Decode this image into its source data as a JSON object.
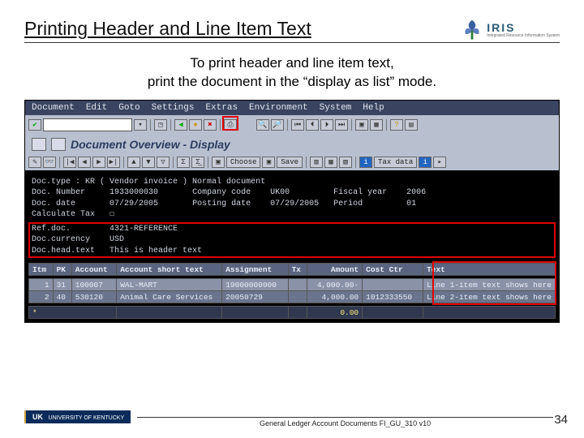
{
  "title": "Printing Header and Line Item Text",
  "subtitle_line1": "To print header and line item text,",
  "subtitle_line2": "print the document in the “display as list” mode.",
  "logo": {
    "text": "IRIS",
    "sub": "Integrated Resource Information System"
  },
  "sap": {
    "menu": [
      "Document",
      "Edit",
      "Goto",
      "Settings",
      "Extras",
      "Environment",
      "System",
      "Help"
    ],
    "overview_title": "Document Overview - Display",
    "toolbar2_buttons": {
      "choose": "Choose",
      "save": "Save",
      "taxdata": "Tax data"
    },
    "header_fields": {
      "doc_type_label": "Doc.type :",
      "doc_type_value": "KR ( Vendor invoice ) Normal document",
      "doc_number_label": "Doc. Number",
      "doc_number_value": "1933000030",
      "company_code_label": "Company code",
      "company_code_value": "UK00",
      "fiscal_year_label": "Fiscal year",
      "fiscal_year_value": "2006",
      "doc_date_label": "Doc. date",
      "doc_date_value": "07/29/2005",
      "posting_date_label": "Posting date",
      "posting_date_value": "07/29/2005",
      "period_label": "Period",
      "period_value": "01",
      "calc_tax_label": "Calculate Tax",
      "ref_doc_label": "Ref.doc.",
      "ref_doc_value": "4321-REFERENCE",
      "doc_currency_label": "Doc.currency",
      "doc_currency_value": "USD",
      "doc_head_text_label": "Doc.head.text",
      "doc_head_text_value": "This is header text"
    },
    "table": {
      "headers": [
        "Itm",
        "PK",
        "Account",
        "Account short text",
        "Assignment",
        "Tx",
        "Amount",
        "Cost Ctr",
        "Text"
      ],
      "rows": [
        {
          "itm": "1",
          "pk": "31",
          "account": "100007",
          "short": "WAL-MART",
          "assign": "19000000000",
          "tx": "",
          "amount": "4,000.00-",
          "cost": "",
          "text": "Line 1-item text shows here"
        },
        {
          "itm": "2",
          "pk": "40",
          "account": "530120",
          "short": "Animal Care Services",
          "assign": "20050729",
          "tx": "",
          "amount": "4,000.00",
          "cost": "1012333550",
          "text": "Line 2-item text shows here"
        }
      ],
      "total_amount": "0.00"
    }
  },
  "footer": {
    "uk": "UK",
    "university": "UNIVERSITY OF KENTUCKY",
    "doc_id": "General Ledger Account Documents FI_GU_310 v10",
    "page": "34"
  }
}
